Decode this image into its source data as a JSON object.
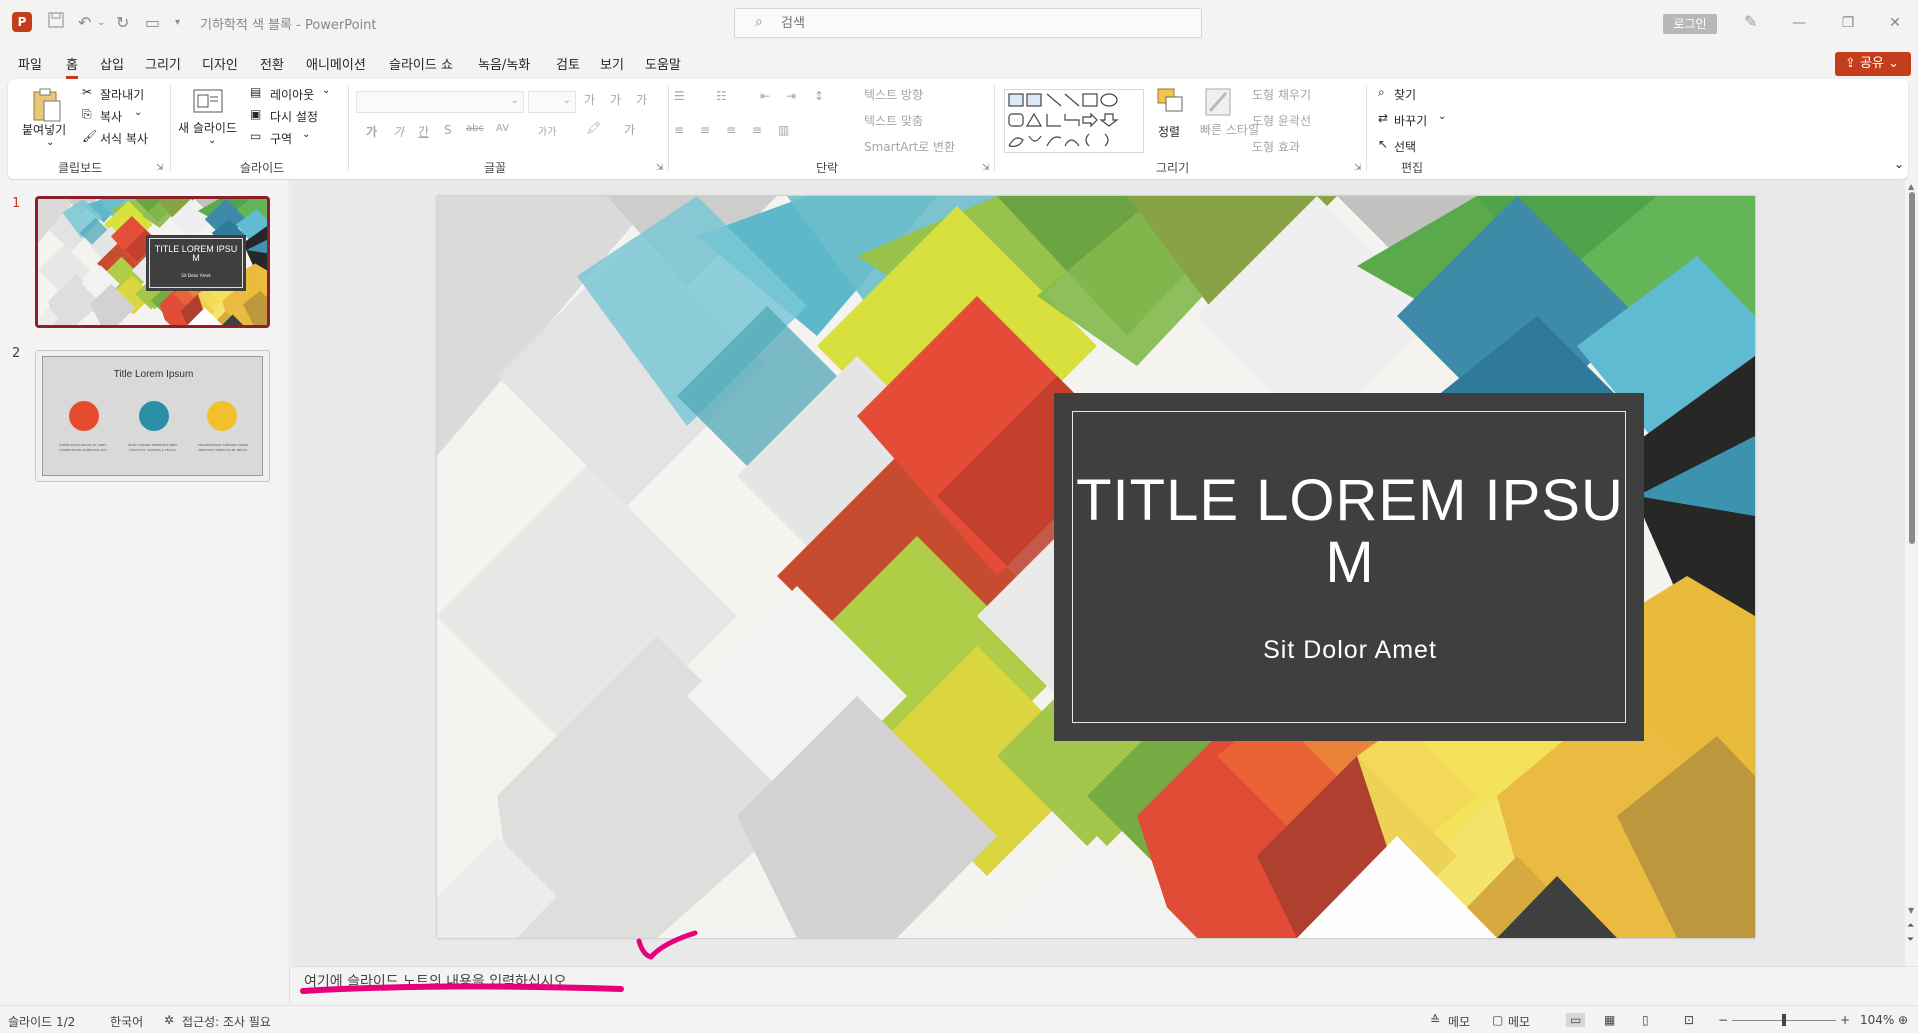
{
  "window": {
    "doc_title": "기하학적 색 블록  -  PowerPoint",
    "search_placeholder": "검색",
    "login_label": "로그인",
    "share_label": "공유"
  },
  "menu": {
    "tabs": [
      "파일",
      "홈",
      "삽입",
      "그리기",
      "디자인",
      "전환",
      "애니메이션",
      "슬라이드 쇼",
      "녹음/녹화",
      "검토",
      "보기",
      "도움말"
    ],
    "active": "홈"
  },
  "ribbon": {
    "clipboard": {
      "paste": "붙여넣기",
      "cut": "잘라내기",
      "copy": "복사",
      "format_painter": "서식 복사",
      "label": "클립보드"
    },
    "slides": {
      "new_slide": "새 슬라이드",
      "layout": "레이아웃",
      "reset": "다시 설정",
      "section": "구역",
      "label": "슬라이드"
    },
    "font": {
      "label": "글꼴",
      "bold": "가",
      "italic": "가",
      "underline": "간",
      "shadow": "S",
      "strikethrough": "abc",
      "spacing": "AV",
      "case": "가가",
      "increase": "가",
      "decrease": "가",
      "clear": "가"
    },
    "paragraph": {
      "text_direction": "텍스트 방향",
      "align_text": "텍스트 맞춤",
      "smartart": "SmartArt로 변환",
      "label": "단락"
    },
    "drawing": {
      "arrange": "정렬",
      "quick_styles": "빠른 스타일",
      "shape_fill": "도형 채우기",
      "shape_outline": "도형 윤곽선",
      "shape_effects": "도형 효과",
      "label": "그리기"
    },
    "editing": {
      "find": "찾기",
      "replace": "바꾸기",
      "select": "선택",
      "label": "편집"
    }
  },
  "thumbnails": [
    {
      "number": "1",
      "title": "TITLE LOREM IPSU M",
      "subtitle": "Sit Dolor Amet"
    },
    {
      "number": "2",
      "title": "Title Lorem Ipsum",
      "captions": [
        "LOREM IPSUM DOLOR SIT AMET, CONSECTETUR ADIPISCING ELIT",
        "NUNC VIVERRA IMPERDIET ENIM. FUSCE EST. VIVAMUS A TELLUS.",
        "PELLENTESQUE HABITANT MORBI TRISTIQUE SENECTUS ET NETUS."
      ]
    }
  ],
  "slide": {
    "title": "TITLE LOREM IPSU M",
    "subtitle": "Sit Dolor Amet"
  },
  "notes": {
    "placeholder": "여기에 슬라이드 노트의 내용을 입력하십시오"
  },
  "status": {
    "slide_counter": "슬라이드 1/2",
    "language": "한국어",
    "accessibility": "접근성: 조사 필요",
    "notes_btn": "메모",
    "comments_btn": "메모",
    "zoom": "104%"
  },
  "colors": {
    "accent": "#c43e1c",
    "selected_thumb_border": "#8b1f2a",
    "title_box": "#3f3f3f",
    "annotation_pink": "#e6007e"
  }
}
